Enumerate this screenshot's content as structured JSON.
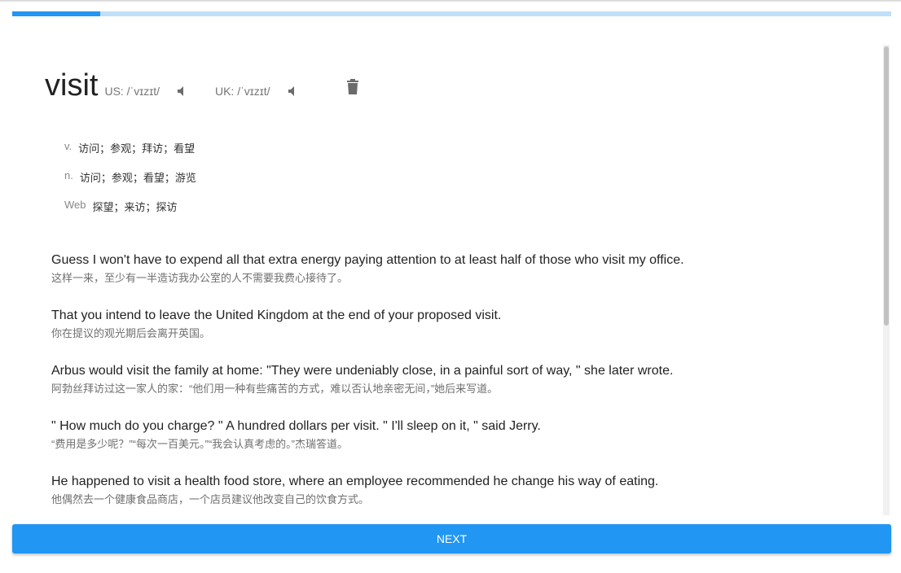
{
  "progress": {
    "fraction": 0.1
  },
  "entry": {
    "word": "visit",
    "us_phonetic": "US: /ˈvɪzɪt/",
    "uk_phonetic": "UK: /ˈvɪzɪt/",
    "us_audio_icon": "speaker-icon",
    "uk_audio_icon": "speaker-icon",
    "delete_icon": "trash-icon"
  },
  "definitions": [
    {
      "pos": "v.",
      "meaning": "访问；参观；拜访；看望"
    },
    {
      "pos": "n.",
      "meaning": "访问；参观；看望；游览"
    },
    {
      "pos": "Web",
      "meaning": "探望；来访；探访"
    }
  ],
  "examples": [
    {
      "en": "Guess I won't have to expend all that extra energy paying attention to at least half of those who visit my office.",
      "zh": "这样一来，至少有一半造访我办公室的人不需要我费心接待了。"
    },
    {
      "en": "That you intend to leave the United Kingdom at the end of your proposed visit.",
      "zh": "你在提议的观光期后会离开英国。"
    },
    {
      "en": "Arbus would visit the family at home: \"They were undeniably close, in a painful sort of way, \" she later wrote.",
      "zh": "阿勃丝拜访过这一家人的家：“他们用一种有些痛苦的方式，难以否认地亲密无间，”她后来写道。"
    },
    {
      "en": "\" How much do you charge? \" A hundred dollars per visit. \" I'll sleep on it, \" said Jerry.",
      "zh": "“费用是多少呢？”“每次一百美元。”“我会认真考虑的。”杰瑞答道。"
    },
    {
      "en": "He happened to visit a health food store, where an employee recommended he change his way of eating.",
      "zh": "他偶然去一个健康食品商店，一个店员建议他改变自己的饮食方式。"
    }
  ],
  "actions": {
    "next_label": "NEXT"
  },
  "colors": {
    "accent": "#2196f3",
    "accent_light": "#bfe0f8"
  }
}
